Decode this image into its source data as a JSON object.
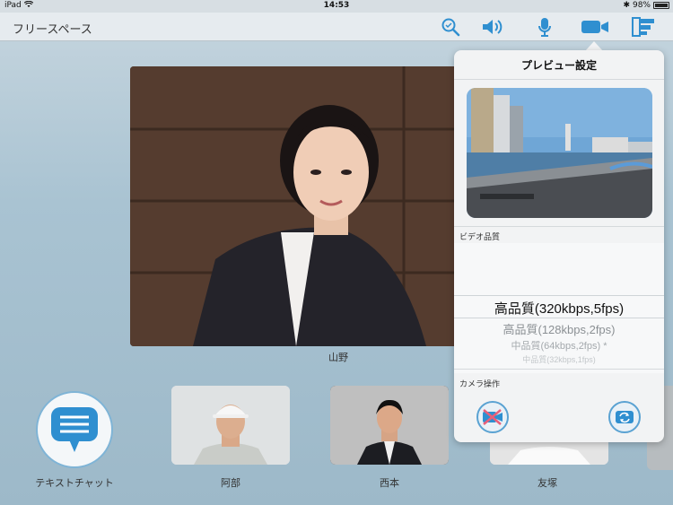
{
  "status_bar": {
    "device": "iPad",
    "time": "14:53",
    "battery": "98%",
    "battery_level": 0.98
  },
  "nav": {
    "title": "フリースペース"
  },
  "main_video": {
    "name": "山野"
  },
  "chat": {
    "label": "テキストチャット"
  },
  "participants": [
    {
      "name": "阿部"
    },
    {
      "name": "西本"
    },
    {
      "name": "友塚"
    }
  ],
  "popover": {
    "title": "プレビュー設定",
    "quality_label": "ビデオ品質",
    "options": [
      "高品質(320kbps,5fps)",
      "高品質(128kbps,2fps)",
      "中品質(64kbps,2fps) *",
      "中品質(32kbps,1fps)"
    ],
    "camera_label": "カメラ操作"
  },
  "colors": {
    "accent": "#2f8fd0",
    "navbar": "#e8ecef",
    "popover": "#f2f3f4"
  }
}
